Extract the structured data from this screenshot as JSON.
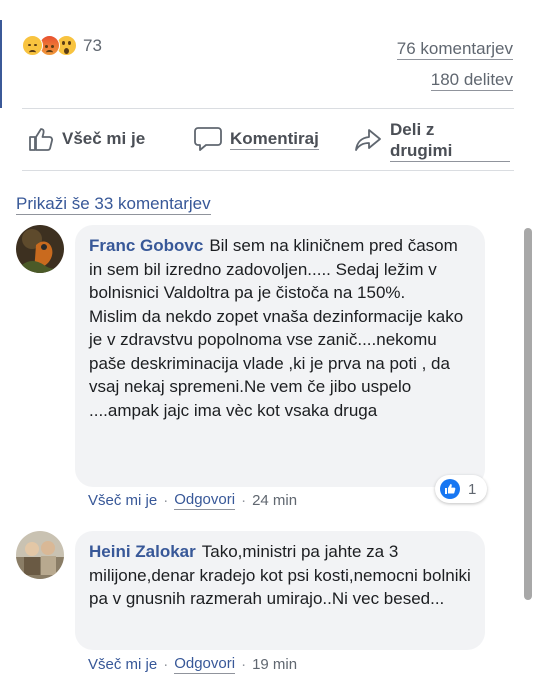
{
  "post": {
    "reaction_count": "73",
    "reactions": [
      "sad-emoji-icon",
      "angry-emoji-icon",
      "wow-emoji-icon"
    ],
    "comments_count": "76 komentarjev",
    "shares_count": "180 delitev"
  },
  "actions": {
    "like": "Všeč mi je",
    "comment": "Komentiraj",
    "share_line1": "Deli z",
    "share_line2": "drugimi"
  },
  "more_comments": "Prikaži še 33 komentarjev",
  "comments": [
    {
      "author": "Franc Gobovc",
      "text": "Bil sem na kliničnem pred časom in sem bil izredno zadovoljen..... Sedaj ležim v bolnisnici Valdoltra pa je čistoča na 150%.",
      "text2": "Mislim da nekdo zopet vnaša dezinformacije kako je v zdravstvu popolnoma vse zanič....nekomu paše deskriminacija vlade ,ki je prva na poti , da vsaj nekaj spremeni.Ne vem če jibo uspelo ....ampak jajc ima vèc kot vsaka druga",
      "like": "Všeč mi je",
      "reply": "Odgovori",
      "time": "24 min",
      "like_count": "1"
    },
    {
      "author": "Heini Zalokar",
      "text": "Tako,ministri pa jahte za 3 milijone,denar kradejo kot psi kosti,nemocni bolniki pa v gnusnih razmerah umirajo..Ni vec besed...",
      "like": "Všeč mi je",
      "reply": "Odgovori",
      "time": "19 min"
    }
  ],
  "colors": {
    "link": "#385898",
    "bubble": "#f2f3f5",
    "like_blue": "#1877f2"
  }
}
